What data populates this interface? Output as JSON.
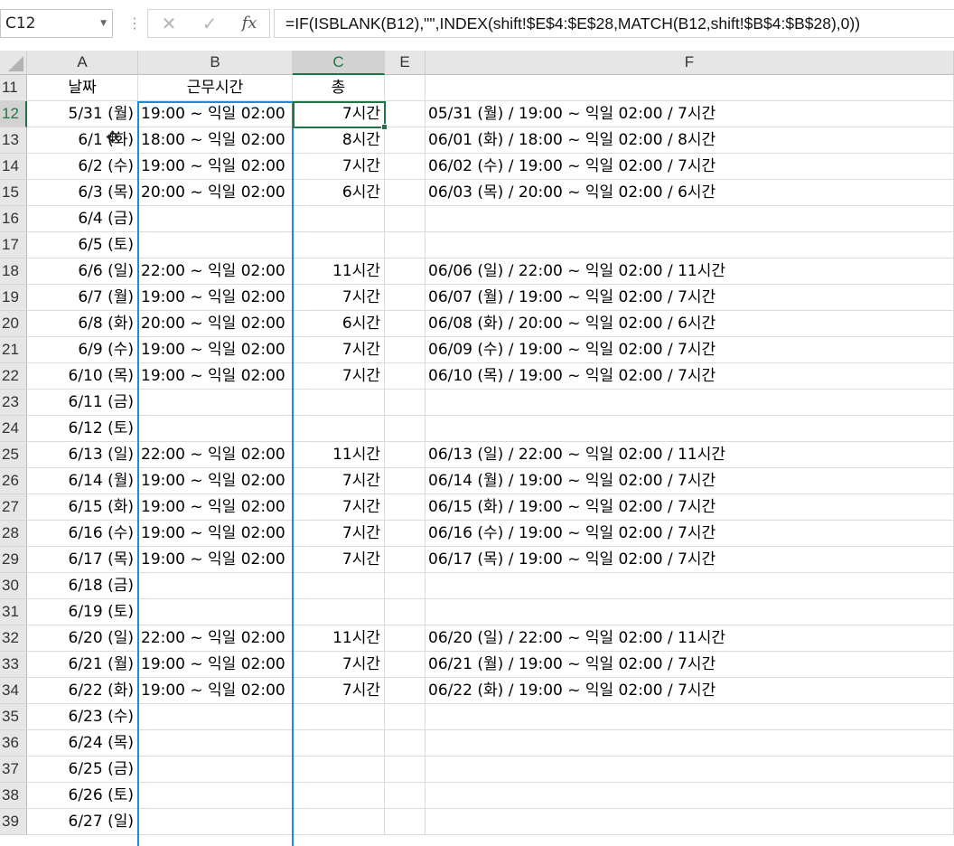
{
  "name_box": "C12",
  "formula": "=IF(ISBLANK(B12),\"\",INDEX(shift!$E$4:$E$28,MATCH(B12,shift!$B$4:$B$28),0))",
  "formula_icons": {
    "cancel": "✕",
    "enter": "✓",
    "fx": "fx"
  },
  "columns": [
    "A",
    "B",
    "C",
    "E",
    "F"
  ],
  "rows": [
    {
      "num": "11",
      "a": "날짜",
      "b": "근무시간",
      "c": "총",
      "f": ""
    },
    {
      "num": "12",
      "a": "5/31 (월)",
      "b": "19:00 ~ 익일 02:00",
      "c": "7시간",
      "f": "05/31 (월) / 19:00 ~ 익일 02:00 / 7시간"
    },
    {
      "num": "13",
      "a": "6/1 (화)",
      "b": "18:00 ~ 익일 02:00",
      "c": "8시간",
      "f": "06/01 (화) / 18:00 ~ 익일 02:00 / 8시간"
    },
    {
      "num": "14",
      "a": "6/2 (수)",
      "b": "19:00 ~ 익일 02:00",
      "c": "7시간",
      "f": "06/02 (수) / 19:00 ~ 익일 02:00 / 7시간"
    },
    {
      "num": "15",
      "a": "6/3 (목)",
      "b": "20:00 ~ 익일 02:00",
      "c": "6시간",
      "f": "06/03 (목) / 20:00 ~ 익일 02:00 / 6시간"
    },
    {
      "num": "16",
      "a": "6/4 (금)",
      "b": "",
      "c": "",
      "f": ""
    },
    {
      "num": "17",
      "a": "6/5 (토)",
      "b": "",
      "c": "",
      "f": ""
    },
    {
      "num": "18",
      "a": "6/6 (일)",
      "b": "22:00 ~ 익일 02:00",
      "c": "11시간",
      "f": "06/06 (일) / 22:00 ~ 익일 02:00 / 11시간"
    },
    {
      "num": "19",
      "a": "6/7 (월)",
      "b": "19:00 ~ 익일 02:00",
      "c": "7시간",
      "f": "06/07 (월) / 19:00 ~ 익일 02:00 / 7시간"
    },
    {
      "num": "20",
      "a": "6/8 (화)",
      "b": "20:00 ~ 익일 02:00",
      "c": "6시간",
      "f": "06/08 (화) / 20:00 ~ 익일 02:00 / 6시간"
    },
    {
      "num": "21",
      "a": "6/9 (수)",
      "b": "19:00 ~ 익일 02:00",
      "c": "7시간",
      "f": "06/09 (수) / 19:00 ~ 익일 02:00 / 7시간"
    },
    {
      "num": "22",
      "a": "6/10 (목)",
      "b": "19:00 ~ 익일 02:00",
      "c": "7시간",
      "f": "06/10 (목) / 19:00 ~ 익일 02:00 / 7시간"
    },
    {
      "num": "23",
      "a": "6/11 (금)",
      "b": "",
      "c": "",
      "f": ""
    },
    {
      "num": "24",
      "a": "6/12 (토)",
      "b": "",
      "c": "",
      "f": ""
    },
    {
      "num": "25",
      "a": "6/13 (일)",
      "b": "22:00 ~ 익일 02:00",
      "c": "11시간",
      "f": "06/13 (일) / 22:00 ~ 익일 02:00 / 11시간"
    },
    {
      "num": "26",
      "a": "6/14 (월)",
      "b": "19:00 ~ 익일 02:00",
      "c": "7시간",
      "f": "06/14 (월) / 19:00 ~ 익일 02:00 / 7시간"
    },
    {
      "num": "27",
      "a": "6/15 (화)",
      "b": "19:00 ~ 익일 02:00",
      "c": "7시간",
      "f": "06/15 (화) / 19:00 ~ 익일 02:00 / 7시간"
    },
    {
      "num": "28",
      "a": "6/16 (수)",
      "b": "19:00 ~ 익일 02:00",
      "c": "7시간",
      "f": "06/16 (수) / 19:00 ~ 익일 02:00 / 7시간"
    },
    {
      "num": "29",
      "a": "6/17 (목)",
      "b": "19:00 ~ 익일 02:00",
      "c": "7시간",
      "f": "06/17 (목) / 19:00 ~ 익일 02:00 / 7시간"
    },
    {
      "num": "30",
      "a": "6/18 (금)",
      "b": "",
      "c": "",
      "f": ""
    },
    {
      "num": "31",
      "a": "6/19 (토)",
      "b": "",
      "c": "",
      "f": ""
    },
    {
      "num": "32",
      "a": "6/20 (일)",
      "b": "22:00 ~ 익일 02:00",
      "c": "11시간",
      "f": "06/20 (일) / 22:00 ~ 익일 02:00 / 11시간"
    },
    {
      "num": "33",
      "a": "6/21 (월)",
      "b": "19:00 ~ 익일 02:00",
      "c": "7시간",
      "f": "06/21 (월) / 19:00 ~ 익일 02:00 / 7시간"
    },
    {
      "num": "34",
      "a": "6/22 (화)",
      "b": "19:00 ~ 익일 02:00",
      "c": "7시간",
      "f": "06/22 (화) / 19:00 ~ 익일 02:00 / 7시간"
    },
    {
      "num": "35",
      "a": "6/23 (수)",
      "b": "",
      "c": "",
      "f": ""
    },
    {
      "num": "36",
      "a": "6/24 (목)",
      "b": "",
      "c": "",
      "f": ""
    },
    {
      "num": "37",
      "a": "6/25 (금)",
      "b": "",
      "c": "",
      "f": ""
    },
    {
      "num": "38",
      "a": "6/26 (토)",
      "b": "",
      "c": "",
      "f": ""
    },
    {
      "num": "39",
      "a": "6/27 (일)",
      "b": "",
      "c": "",
      "f": ""
    }
  ],
  "selection": {
    "active_cell": "C12",
    "range_column": "B"
  },
  "colors": {
    "active_green": "#217346",
    "range_blue": "#1c8ad6",
    "header_gray": "#e6e6e6"
  }
}
